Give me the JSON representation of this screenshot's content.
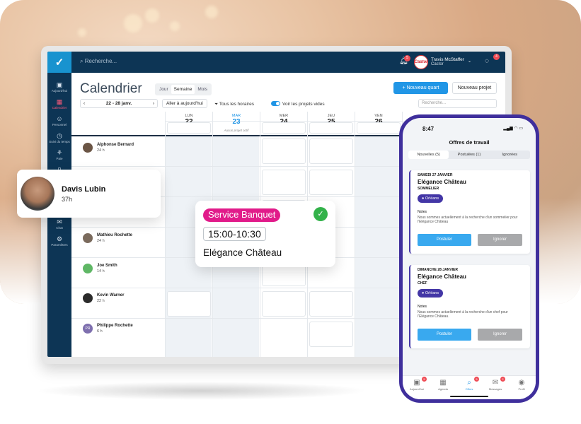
{
  "topbar": {
    "search_placeholder": "Recherche...",
    "bell_count": "5",
    "user_name": "Travis McStaffer",
    "user_company": "Castor",
    "company_logo": "Castor",
    "chat_count": "4"
  },
  "sidebar": {
    "items": [
      {
        "label": "Aujourd'hui",
        "icon": "clipboard-icon"
      },
      {
        "label": "Calendrier",
        "icon": "calendar-icon"
      },
      {
        "label": "Personnel",
        "icon": "people-icon"
      },
      {
        "label": "Suivi du temps",
        "icon": "clock-icon"
      },
      {
        "label": "Paie",
        "icon": "network-icon"
      },
      {
        "label": "Rapports",
        "icon": "book-icon"
      },
      {
        "label": "Chat",
        "icon": "chat-icon"
      },
      {
        "label": "Paramètres",
        "icon": "gear-icon"
      }
    ]
  },
  "calendar": {
    "title": "Calendrier",
    "views": [
      "Jour",
      "Semaine",
      "Mois"
    ],
    "selected_view": "Semaine",
    "new_shift": "Nouveau quart",
    "new_project": "Nouveau projet",
    "date_range": "22 - 28 janv.",
    "go_today": "Aller à aujourd'hui",
    "filter_schedules": "Tous les horaires",
    "show_empty": "Voir les projets vides",
    "search_placeholder": "Recherche...",
    "no_project": "Aucun projet actif",
    "days": [
      {
        "name": "LUN",
        "num": "22"
      },
      {
        "name": "MAR",
        "num": "23"
      },
      {
        "name": "MER",
        "num": "24"
      },
      {
        "name": "JEU",
        "num": "25"
      },
      {
        "name": "VEN",
        "num": "26"
      }
    ],
    "employees": [
      {
        "name": "Alphonse Bernard",
        "hours": "24 h"
      },
      {
        "name": "Mathieu Rochette",
        "hours": "24 h"
      },
      {
        "name": "Joe Smith",
        "hours": "14 h"
      },
      {
        "name": "Kevin Warner",
        "hours": "22 h"
      },
      {
        "name": "Philippe Rochette",
        "hours": "6 h",
        "initials": "PR"
      }
    ],
    "partial_hours": "24 h"
  },
  "employee_card": {
    "name": "Davis Lubin",
    "hours": "37h"
  },
  "shift_card": {
    "tag": "Service Banquet",
    "time": "15:00-10:30",
    "venue": "Elégance Château",
    "tag_color": "#e11b8a",
    "check_color": "#33b24a"
  },
  "phone": {
    "time": "8:47",
    "title": "Offres de travail",
    "tabs": [
      "Nouvelles (5)",
      "Postulées (1)",
      "Ignorées"
    ],
    "offers": [
      {
        "date": "SAMEDI 27 JANVIER",
        "venue": "Elégance Château",
        "role": "SOMMELIER",
        "location": "Orléans",
        "notes_label": "Notes",
        "notes": "Nous sommes actuellement à la recherche d'un sommelier pour l'Elégance Château",
        "apply": "Postuler",
        "ignore": "Ignorer"
      },
      {
        "date": "DIMANCHE 28 JANVIER",
        "venue": "Elégance Château",
        "role": "CHEF",
        "location": "Orléans",
        "notes_label": "Notes",
        "notes": "Nous sommes actuellement à la recherche d'un chef pour l'Elégance Château.",
        "apply": "Postuler",
        "ignore": "Ignorer"
      }
    ],
    "nav": [
      {
        "label": "Aujourd'hui",
        "icon": "clipboard-icon",
        "badge": "5"
      },
      {
        "label": "Agenda",
        "icon": "calendar-icon",
        "badge": ""
      },
      {
        "label": "Offres",
        "icon": "search-icon",
        "badge": "5"
      },
      {
        "label": "Messages",
        "icon": "chat-icon",
        "badge": "2"
      },
      {
        "label": "Profil",
        "icon": "user-icon",
        "badge": ""
      }
    ],
    "accent_color": "#4336a6"
  }
}
